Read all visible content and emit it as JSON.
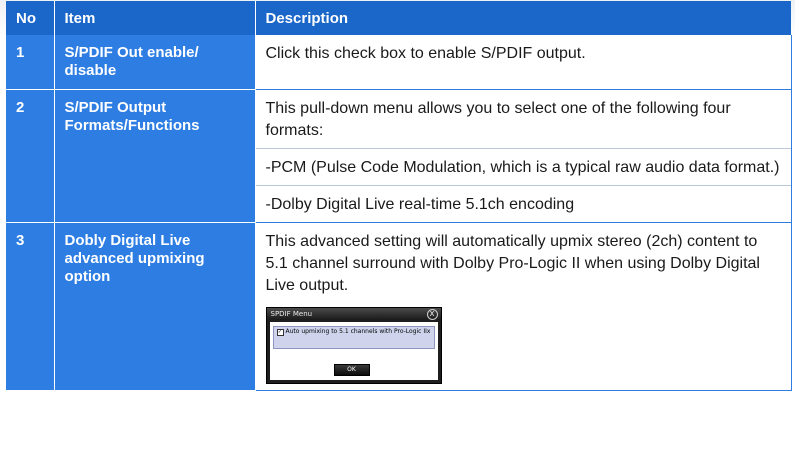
{
  "headers": {
    "no": "No",
    "item": "Item",
    "description": "Description"
  },
  "rows": [
    {
      "no": "1",
      "item_line1": "S/PDIF Out enable/",
      "item_line2": "disable",
      "desc": [
        "Click this check box to enable S/PDIF output."
      ]
    },
    {
      "no": "2",
      "item_line1": "S/PDIF Output",
      "item_line2": "Formats/Functions",
      "desc": [
        "This pull-down menu allows you to select one of the following four formats:",
        "-PCM (Pulse Code Modulation, which is a typical raw audio data format.)",
        "-Dolby Digital Live real-time 5.1ch encoding"
      ]
    },
    {
      "no": "3",
      "item_line1": "Dobly Digital Live",
      "item_line2": "advanced upmixing",
      "item_line3": "option",
      "desc": [
        "This advanced setting will automatically upmix stereo (2ch) content to 5.1 channel surround with Dolby Pro-Logic II when using Dolby Digital Live output."
      ]
    }
  ],
  "dialog": {
    "title": "SPDIF Menu",
    "close": "X",
    "checkbox_mark": "✓",
    "option_label": "Auto upmixing to 5.1 channels with Pro-Logic IIx",
    "ok_label": "OK"
  },
  "colors": {
    "header": "#1b66c9",
    "cell": "#2d7de3"
  }
}
